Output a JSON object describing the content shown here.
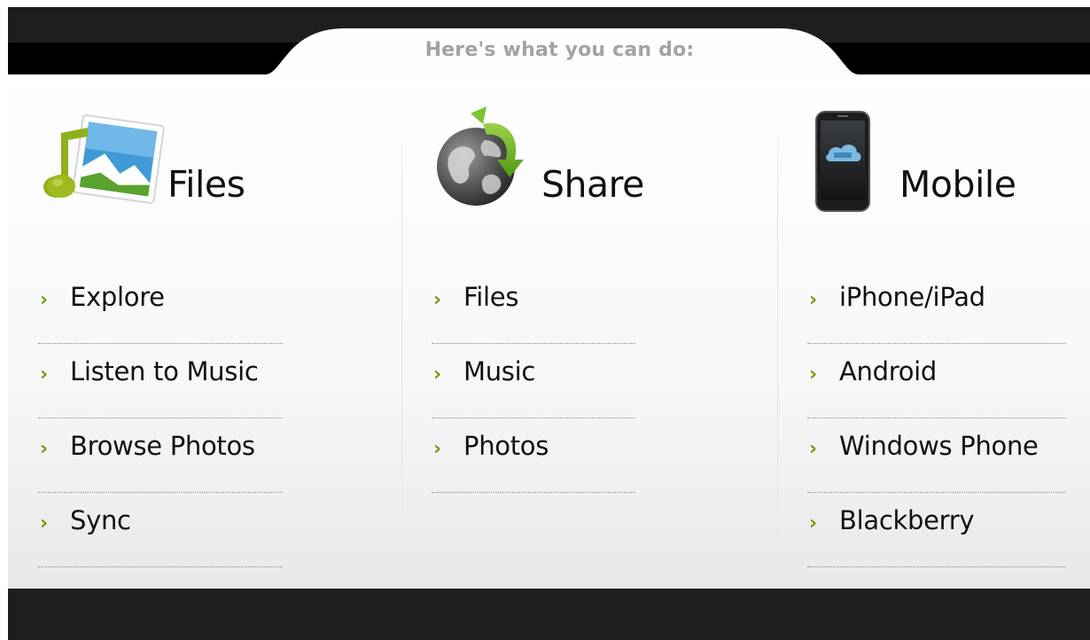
{
  "header": {
    "title": "Here's what you can do:"
  },
  "columns": [
    {
      "id": "files",
      "title": "Files",
      "icon": "music-photo-icon",
      "items": [
        "Explore",
        "Listen to Music",
        "Browse Photos",
        "Sync"
      ]
    },
    {
      "id": "share",
      "title": "Share",
      "icon": "globe-share-icon",
      "items": [
        "Files",
        "Music",
        "Photos"
      ]
    },
    {
      "id": "mobile",
      "title": "Mobile",
      "icon": "smartphone-icon",
      "items": [
        "iPhone/iPad",
        "Android",
        "Windows Phone",
        "Blackberry"
      ]
    }
  ],
  "colors": {
    "accent": "#6f9a05",
    "header_text": "#a3a3a3",
    "dark_bar": "#1e1e1e"
  }
}
